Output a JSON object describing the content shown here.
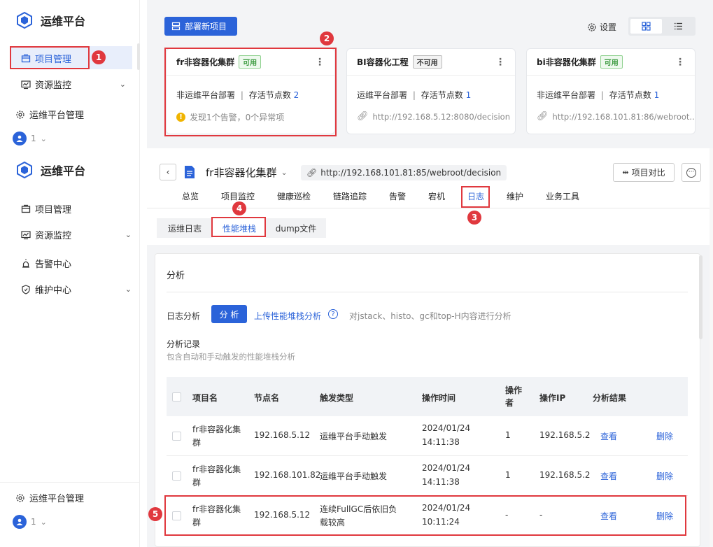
{
  "app": {
    "name": "运维平台"
  },
  "top_sidebar": {
    "items": [
      {
        "label": "项目管理",
        "icon": "project-icon"
      },
      {
        "label": "资源监控",
        "icon": "monitor-icon"
      }
    ],
    "manage_label": "运维平台管理",
    "user_num": "1"
  },
  "annotations": [
    "1",
    "2",
    "3",
    "4",
    "5"
  ],
  "top_main": {
    "deploy_button": "部署新项目",
    "settings_label": "设置",
    "cards": [
      {
        "title": "fr非容器化集群",
        "status": "可用",
        "status_type": "ok",
        "deploy": "非运维平台部署",
        "sep": "|",
        "nodes_label": "存活节点数",
        "nodes": "2",
        "info": "发现1个告警，0个异常项",
        "info_type": "warning"
      },
      {
        "title": "BI容器化工程",
        "status": "不可用",
        "status_type": "no",
        "deploy": "运维平台部署",
        "sep": "|",
        "nodes_label": "存活节点数",
        "nodes": "1",
        "info": "http://192.168.5.12:8080/decision",
        "info_type": "link"
      },
      {
        "title": "bi非容器化集群",
        "status": "可用",
        "status_type": "ok",
        "deploy": "非运维平台部署",
        "sep": "|",
        "nodes_label": "存活节点数",
        "nodes": "1",
        "info": "http://192.168.101.81:86/webroot...",
        "info_type": "link"
      }
    ]
  },
  "bottom_sidebar": {
    "items": [
      {
        "label": "项目管理"
      },
      {
        "label": "资源监控"
      },
      {
        "label": "告警中心"
      },
      {
        "label": "维护中心"
      }
    ],
    "manage_label": "运维平台管理",
    "user_num": "1"
  },
  "project_header": {
    "title": "fr非容器化集群",
    "url": "http://192.168.101.81:85/webroot/decision",
    "compare_button": "项目对比"
  },
  "tabs": [
    "总览",
    "项目监控",
    "健康巡检",
    "链路追踪",
    "告警",
    "宕机",
    "日志",
    "维护",
    "业务工具"
  ],
  "active_tab": "日志",
  "subtabs": [
    "运维日志",
    "性能堆栈",
    "dump文件"
  ],
  "active_subtab": "性能堆栈",
  "analysis": {
    "section_title": "分析",
    "log_analysis_label": "日志分析",
    "analyze_button": "分 析",
    "upload_link": "上传性能堆栈分析",
    "help_text": "对jstack、histo、gc和top-H内容进行分析",
    "records_title": "分析记录",
    "records_desc": "包含自动和手动触发的性能堆栈分析"
  },
  "table": {
    "columns": [
      "项目名",
      "节点名",
      "触发类型",
      "操作时间",
      "操作者",
      "操作IP",
      "分析结果"
    ],
    "rows": [
      {
        "project": "fr非容器化集群",
        "node": "192.168.5.12",
        "trigger": "运维平台手动触发",
        "date": "2024/01/24",
        "time": "14:11:38",
        "operator": "1",
        "ip": "192.168.5.2",
        "view": "查看",
        "delete": "删除"
      },
      {
        "project": "fr非容器化集群",
        "node": "192.168.101.82",
        "trigger": "运维平台手动触发",
        "date": "2024/01/24",
        "time": "14:11:38",
        "operator": "1",
        "ip": "192.168.5.2",
        "view": "查看",
        "delete": "删除"
      },
      {
        "project": "fr非容器化集群",
        "node": "192.168.5.12",
        "trigger": "连续FullGC后依旧负载较高",
        "date": "2024/01/24",
        "time": "10:11:24",
        "operator": "-",
        "ip": "-",
        "view": "查看",
        "delete": "删除"
      }
    ]
  },
  "colors": {
    "primary": "#2b63d9",
    "annotation": "#e0383e",
    "ok": "#3a9a3e",
    "warning": "#f0b400"
  }
}
